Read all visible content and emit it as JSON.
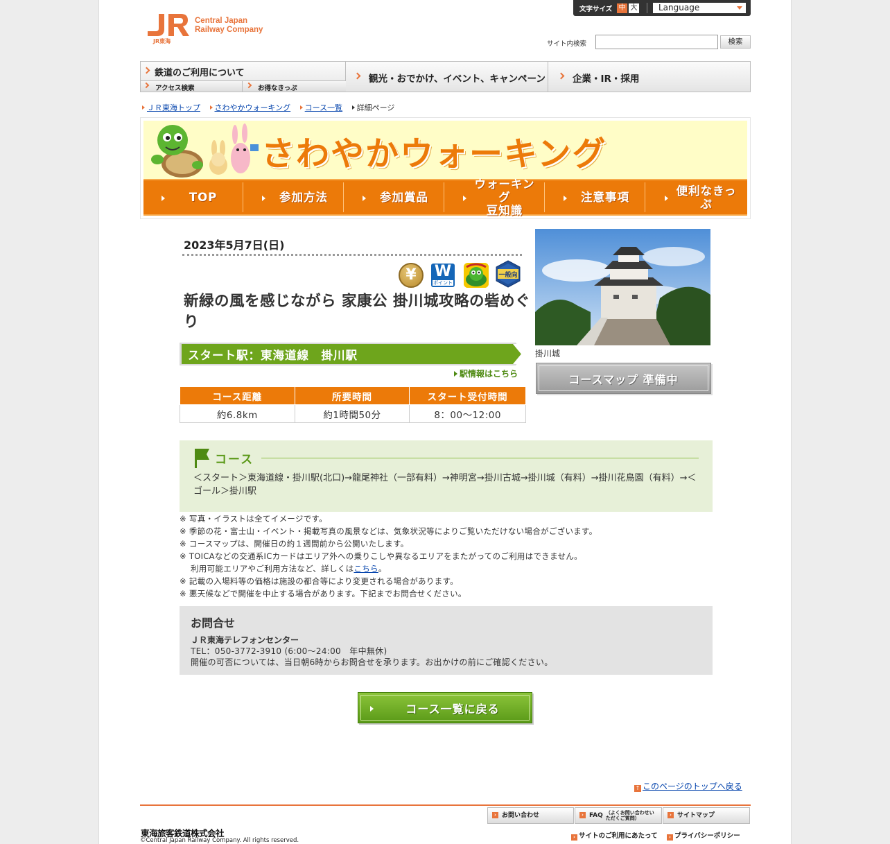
{
  "header": {
    "logo_company_line1": "Central Japan",
    "logo_company_line2": "Railway Company",
    "font_size_label": "文字サイズ",
    "font_size_mid": "中",
    "font_size_large": "大",
    "language_label": "Language",
    "search_label": "サイト内検索",
    "search_value": "",
    "search_button": "検索"
  },
  "global_nav": {
    "railway": "鉄道のご利用について",
    "access_search": "アクセス検索",
    "tickets": "お得なきっぷ",
    "sightseeing": "観光・おでかけ、イベント、キャンペーン",
    "corporate": "企業・IR・採用"
  },
  "breadcrumb": [
    "ＪＲ東海トップ",
    "さわやかウォーキング",
    "コース一覧",
    "詳細ページ"
  ],
  "banner": {
    "title": "さわやかウォーキング",
    "nav": [
      "TOP",
      "参加方法",
      "参加賞品",
      "ウォーキング\n豆知識",
      "注意事項",
      "便利なきっぷ"
    ]
  },
  "event": {
    "date": "2023年5月7日(日)",
    "badges": {
      "yen": "¥",
      "w_big": "W",
      "w_small": "ポイント",
      "general": "一般向"
    },
    "title": "新緑の風を感じながら 家康公 掛川城攻略の砦めぐり",
    "start_station": "スタート駅：東海道線　掛川駅",
    "station_info_link": "駅情報はこちら",
    "table_headers": [
      "コース距離",
      "所要時間",
      "スタート受付時間"
    ],
    "table_values": [
      "約6.8km",
      "約1時間50分",
      "8：00～12:00"
    ],
    "photo_caption": "掛川城",
    "map_button": "コースマップ 準備中"
  },
  "course": {
    "heading": "コース",
    "route": "＜スタート＞東海道線・掛川駅(北口)→龍尾神社（一部有料）→神明宮→掛川古城→掛川城（有料）→掛川花鳥園（有料）→＜ゴール＞掛川駅"
  },
  "notes": {
    "n1": "※ 写真・イラストは全てイメージです。",
    "n2": "※ 季節の花・富士山・イベント・掲載写真の風景などは、気象状況等によりご覧いただけない場合がございます。",
    "n3": "※ コースマップは、開催日の約１週間前から公開いたします。",
    "n4": "※ TOICAなどの交通系ICカードはエリア外への乗りこしや異なるエリアをまたがってのご利用はできません。",
    "n4_cont_prefix": "利用可能エリアやご利用方法など、詳しくは",
    "n4_link": "こちら",
    "n4_cont_suffix": "。",
    "n5": "※ 記載の入場料等の価格は施設の都合等により変更される場合があります。",
    "n6": "※ 悪天候などで開催を中止する場合があります。下記までお問合せください。"
  },
  "contact": {
    "title": "お問合せ",
    "org": "ＪＲ東海テレフォンセンター",
    "tel": "TEL：050-3772-3910 (6:00～24:00　年中無休)",
    "note": "開催の可否については、当日朝6時からお問合せを承ります。お出かけの前にご確認ください。"
  },
  "back_button": "コース一覧に戻る",
  "to_top": "このページのトップへ戻る",
  "footer": {
    "contact": "お問い合わせ",
    "faq_main": "FAQ",
    "faq_sub": "（よくお問い合わせいただくご質問）",
    "sitemap": "サイトマップ",
    "site_terms": "サイトのご利用にあたって",
    "privacy": "プライバシーポリシー",
    "company": "東海旅客鉄道株式会社",
    "copyright": "©Central Japan Railway Company. All rights reserved."
  },
  "colors": {
    "accent_orange": "#ec7a09",
    "jr_orange": "#e8743b",
    "course_green": "#5c9a1a",
    "link_blue": "#0645ad"
  }
}
